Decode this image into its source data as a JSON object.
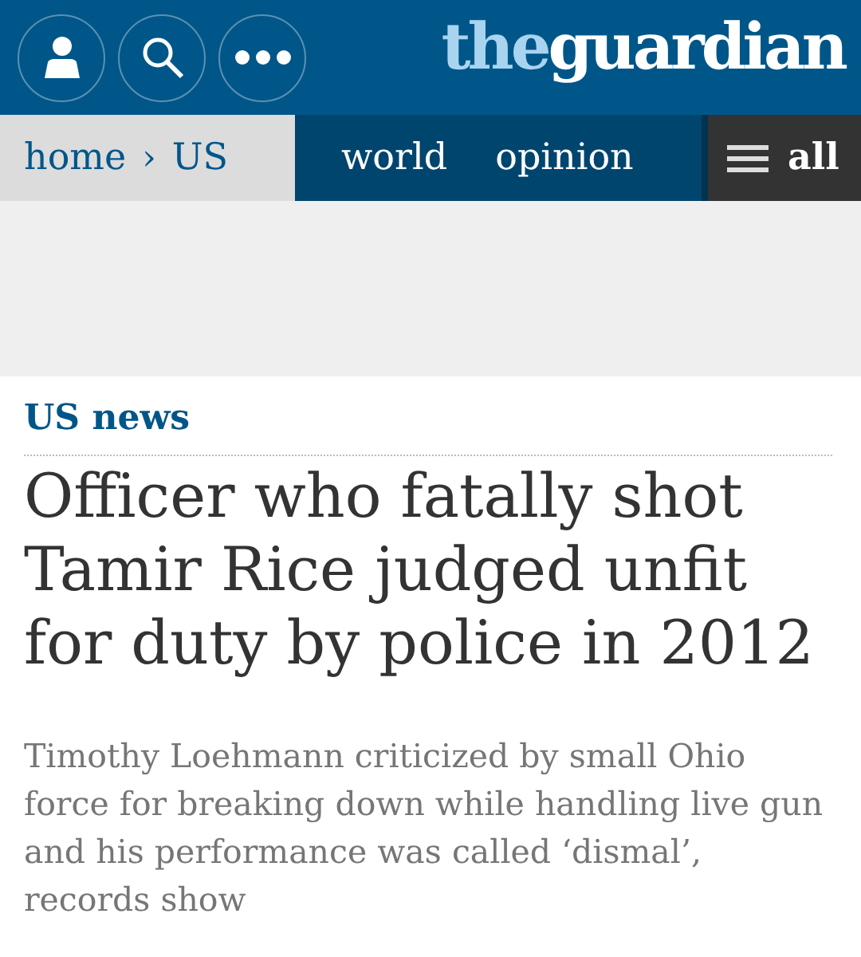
{
  "header": {
    "buttons": [
      {
        "kind": "profile"
      },
      {
        "kind": "search"
      },
      {
        "kind": "more"
      }
    ],
    "logo": {
      "part_1": "the",
      "part_2": "guardian"
    }
  },
  "nav": {
    "breadcrumb": [
      {
        "label": "home"
      },
      {
        "label": "US"
      }
    ],
    "separator": "›",
    "sections": [
      {
        "label": "world"
      },
      {
        "label": "opinion"
      }
    ],
    "all_button": "all"
  },
  "ad": {
    "kind": "empty"
  },
  "article": {
    "section": "US news",
    "headline": "Officer who fatally shot Tamir Rice judged unfit for duty by police in 2012",
    "standfirst": "Timothy Loehmann criticized by small Ohio force for breaking down while handling live gun and his performance was called ‘dismal’, records show"
  }
}
